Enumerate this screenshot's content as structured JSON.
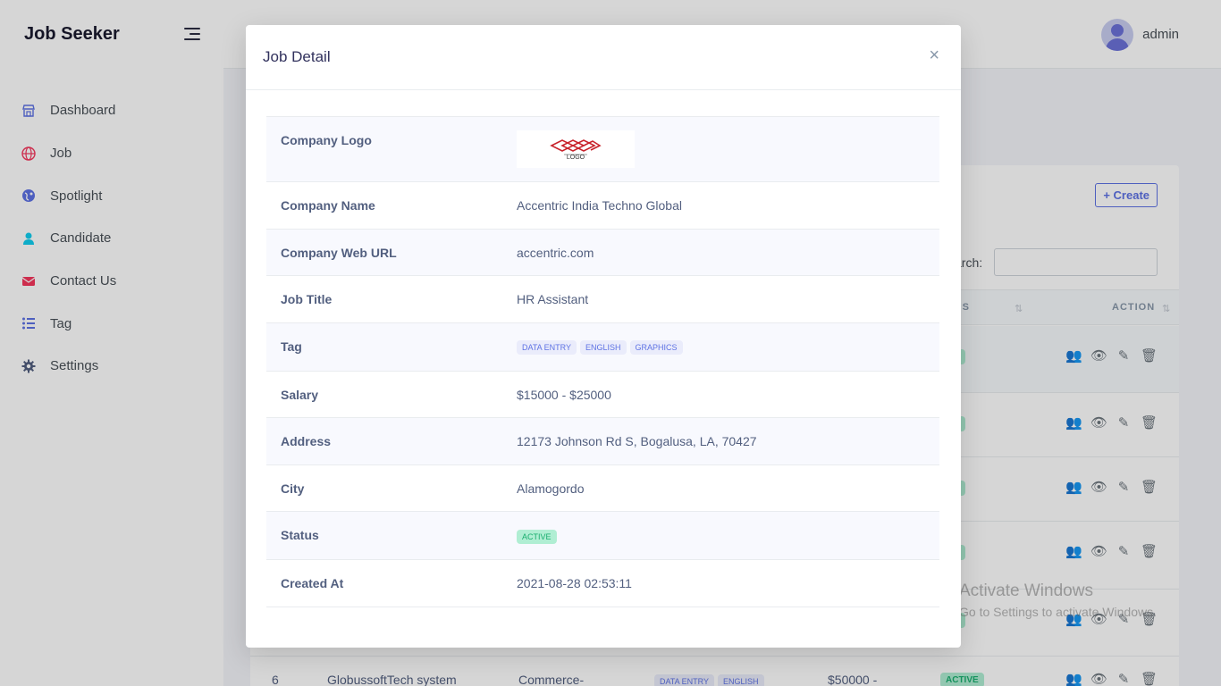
{
  "app": {
    "brand": "Job Seeker"
  },
  "sidebar": {
    "items": [
      {
        "label": "Dashboard",
        "icon": "shop-icon",
        "color": "#5e72e4"
      },
      {
        "label": "Job",
        "icon": "globe-icon",
        "color": "#f5365c"
      },
      {
        "label": "Spotlight",
        "icon": "planet-icon",
        "color": "#5e72e4"
      },
      {
        "label": "Candidate",
        "icon": "user-icon",
        "color": "#11cdef"
      },
      {
        "label": "Contact Us",
        "icon": "envelope-icon",
        "color": "#f5365c"
      },
      {
        "label": "Tag",
        "icon": "list-icon",
        "color": "#5e72e4"
      },
      {
        "label": "Settings",
        "icon": "gear-icon",
        "color": "#525f7f"
      }
    ]
  },
  "header": {
    "username": "admin"
  },
  "background": {
    "create_label": "Create",
    "search_label": "arch:",
    "columns": {
      "status": "TUS",
      "action": "ACTION"
    },
    "row_badge": "IVE",
    "last_row": {
      "index": "6",
      "company": "GlobussoftTech system",
      "category": "Commerce-",
      "tags": [
        "DATA ENTRY",
        "ENGLISH"
      ],
      "salary": "$50000 -",
      "status": "ACTIVE"
    }
  },
  "modal": {
    "title": "Job Detail",
    "close": "×",
    "logo_text": "LOGO",
    "rows": {
      "logo_label": "Company Logo",
      "company_name_label": "Company Name",
      "company_name": "Accentric India Techno Global",
      "web_url_label": "Company Web URL",
      "web_url": "accentric.com",
      "job_title_label": "Job Title",
      "job_title": "HR Assistant",
      "tag_label": "Tag",
      "tags": [
        "DATA ENTRY",
        "ENGLISH",
        "GRAPHICS"
      ],
      "salary_label": "Salary",
      "salary": "$15000 - $25000",
      "address_label": "Address",
      "address": "12173 Johnson Rd S, Bogalusa, LA, 70427",
      "city_label": "City",
      "city": "Alamogordo",
      "status_label": "Status",
      "status": "ACTIVE",
      "created_label": "Created At",
      "created": "2021-08-28 02:53:11"
    }
  },
  "watermark": {
    "line1": "Activate Windows",
    "line2": "Go to Settings to activate Windows."
  }
}
